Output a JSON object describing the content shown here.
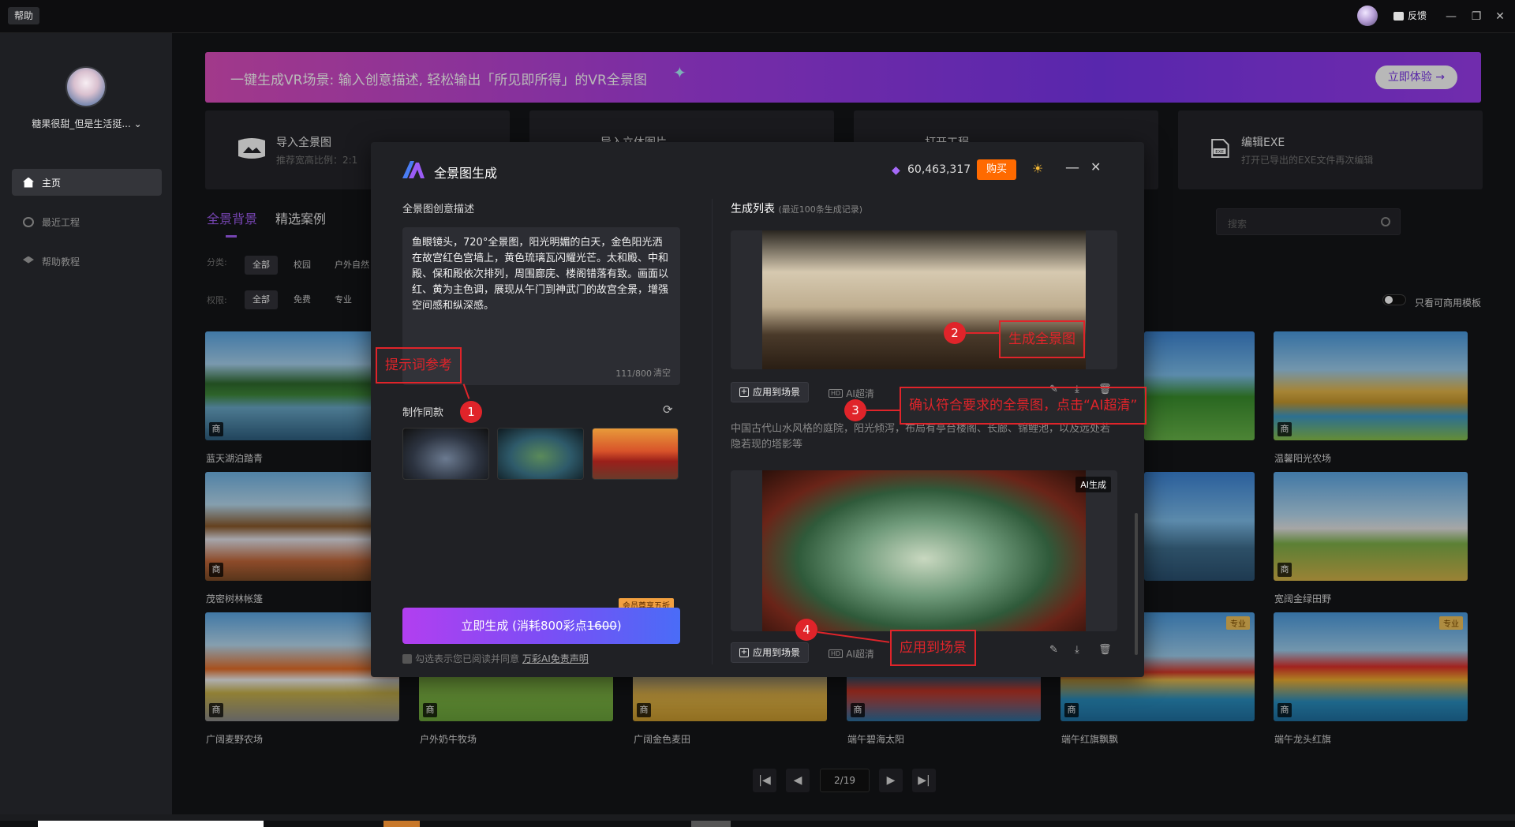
{
  "titlebar": {
    "help": "帮助",
    "feedback": "反馈",
    "minimize": "—",
    "restore": "❐",
    "close": "✕"
  },
  "sidebar": {
    "user_name": "糖果很甜_但是生活挺... ⌄",
    "items": [
      {
        "label": "主页",
        "icon": "home-icon"
      },
      {
        "label": "最近工程",
        "icon": "clock-icon"
      },
      {
        "label": "帮助教程",
        "icon": "graduation-cap-icon"
      }
    ]
  },
  "banner": {
    "text": "一键生成VR场景: 输入创意描述, 轻松输出「所见即所得」的VR全景图",
    "button": "立即体验 →"
  },
  "cards": [
    {
      "title": "导入全景图",
      "sub": "推荐宽高比例：2:1"
    },
    {
      "title": "导入立体图片",
      "sub": ""
    },
    {
      "title": "打开工程",
      "sub": ""
    },
    {
      "title": "编辑EXE",
      "sub": "打开已导出的EXE文件再次编辑"
    }
  ],
  "tabs": [
    "全景背景",
    "精选案例"
  ],
  "filters": {
    "category_label": "分类:",
    "category_options": [
      "全部",
      "校园",
      "户外自然"
    ],
    "permission_label": "权限:",
    "permission_options": [
      "全部",
      "免费",
      "专业"
    ]
  },
  "search": {
    "placeholder": "搜索"
  },
  "commercial_toggle": {
    "label": "只看可商用模板",
    "on": false
  },
  "gallery": {
    "badge_commercial": "商",
    "badge_pro": "专业",
    "items": [
      {
        "title": "蓝天湖泊踏青"
      },
      {
        "title": "温馨阳光农场"
      },
      {
        "title": "茂密树林帐篷"
      },
      {
        "title": "宽阔金绿田野"
      },
      {
        "title": "广阔麦野农场"
      },
      {
        "title": "户外奶牛牧场"
      },
      {
        "title": "广阔金色麦田"
      },
      {
        "title": "端午碧海太阳"
      },
      {
        "title": "端午红旗飘飘"
      },
      {
        "title": "端午龙头红旗"
      }
    ]
  },
  "pagination": {
    "first": "|◀",
    "prev": "◀",
    "current": "2/19",
    "next": "▶",
    "last": "▶|"
  },
  "modal": {
    "title": "全景图生成",
    "points": "60,463,317",
    "buy": "购买",
    "desc_label": "全景图创意描述",
    "prompt": "鱼眼镜头，720°全景图，阳光明媚的白天，金色阳光洒在故宫红色宫墙上，黄色琉璃瓦闪耀光芒。太和殿、中和殿、保和殿依次排列，周围廊庑、楼阁错落有致。画面以红、黄为主色调，展现从午门到神武门的故宫全景，增强空间感和纵深感。",
    "char_count": "111/800",
    "clear": "清空",
    "same_style_label": "制作同款",
    "generate_prefix": "立即生成 (消耗800彩点",
    "generate_strike": "1600",
    "generate_suffix": ")",
    "vip_badge": "会员尊享五折",
    "agreement_prefix": "勾选表示您已阅读并同意",
    "agreement_link": "万彩AI免责声明",
    "list_title": "生成列表",
    "list_sub": "(最近100条生成记录)",
    "apply_label": "应用到场景",
    "hd_label": "AI超清",
    "ai_tag": "AI生成",
    "caption": "中国古代山水风格的庭院，阳光倾泻，布局有亭台楼阁、长廊、锦鲤池，以及远处若隐若现的塔影等"
  },
  "annotations": {
    "a1": "提示词参考",
    "a2": "生成全景图",
    "a3": "确认符合要求的全景图，点击“AI超清”",
    "a4": "应用到场景",
    "n1": "1",
    "n2": "2",
    "n3": "3",
    "n4": "4"
  },
  "colors": {
    "accent": "#a35ff5",
    "buy": "#ff6a00",
    "annotation": "#e0242a"
  }
}
